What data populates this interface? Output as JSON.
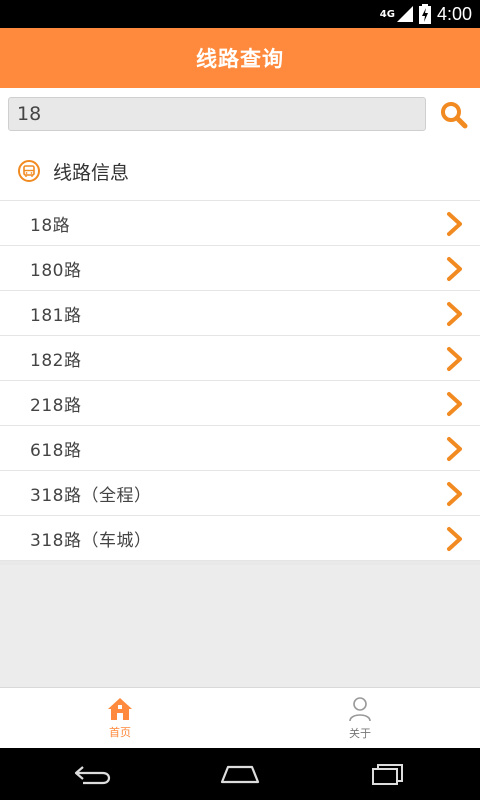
{
  "status": {
    "time": "4:00",
    "network": "4G"
  },
  "header": {
    "title": "线路查询"
  },
  "search": {
    "value": "18"
  },
  "section": {
    "title": "线路信息"
  },
  "routes": [
    "18路",
    "180路",
    "181路",
    "182路",
    "218路",
    "618路",
    "318路（全程）",
    "318路（车城）"
  ],
  "tabs": {
    "home": "首页",
    "about": "关于"
  },
  "colors": {
    "accent": "#ff8a3d",
    "chevron": "#f28a22"
  }
}
